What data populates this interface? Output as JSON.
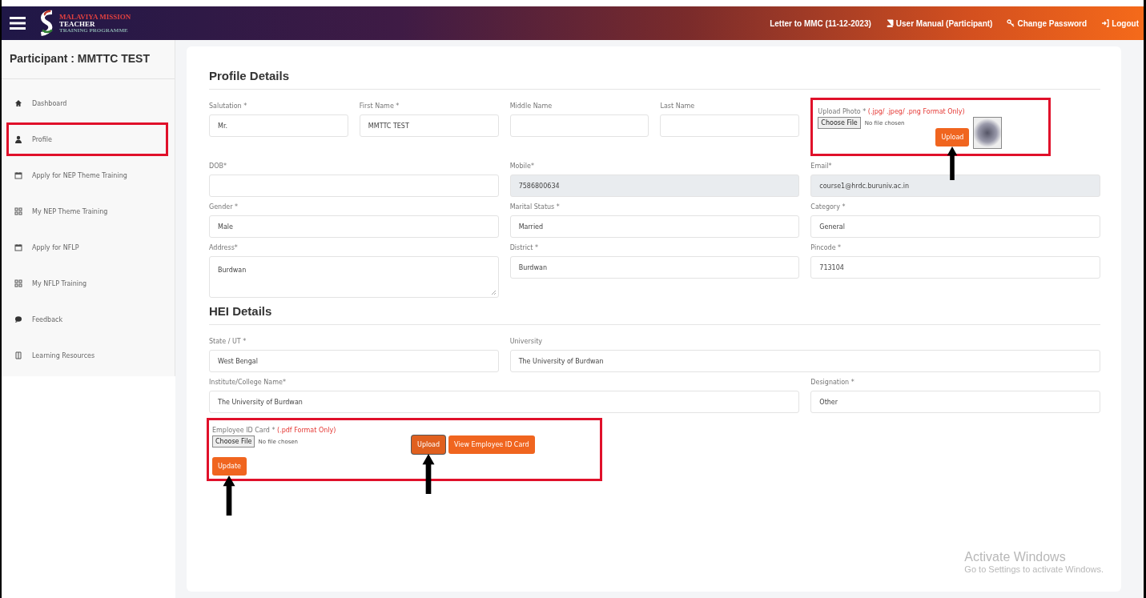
{
  "header": {
    "logo_lines": [
      "MALAVIYA MISSION",
      "TEACHER",
      "TRAINING PROGRAMME"
    ],
    "links": [
      {
        "label": "Letter to MMC (11-12-2023)"
      },
      {
        "label": "User Manual (Participant)"
      },
      {
        "label": "Change Password"
      },
      {
        "label": "Logout"
      }
    ]
  },
  "sidebar": {
    "title": "Participant : MMTTC TEST",
    "items": [
      {
        "label": "Dashboard",
        "highlighted": false
      },
      {
        "label": "Profile",
        "highlighted": true
      },
      {
        "label": "Apply for NEP Theme Training",
        "highlighted": false
      },
      {
        "label": "My NEP Theme Training",
        "highlighted": false
      },
      {
        "label": "Apply for NFLP",
        "highlighted": false
      },
      {
        "label": "My NFLP Training",
        "highlighted": false
      },
      {
        "label": "Feedback",
        "highlighted": false
      },
      {
        "label": "Learning Resources",
        "highlighted": false
      }
    ]
  },
  "sections": [
    {
      "title": "Profile Details",
      "fields": [
        {
          "kind": "input",
          "label": "Salutation *",
          "value": "Mr."
        },
        {
          "kind": "input",
          "label": "First Name *",
          "value": "MMTTC TEST"
        },
        {
          "kind": "input",
          "label": "Middle Name"
        },
        {
          "kind": "input",
          "label": "Last Name"
        },
        {
          "kind": "upload",
          "label": "Upload Photo *",
          "hint": "(.jpg/ .jpeg/ .png Format Only)",
          "choose": "Choose File",
          "file_status": "No file chosen",
          "button": "Upload",
          "pointed": true,
          "highlighted": true,
          "thumbnail": true
        },
        {
          "kind": "input",
          "label": "DOB*"
        },
        {
          "kind": "input",
          "label": "Mobile*",
          "value": "7586800634",
          "readonly": true
        },
        {
          "kind": "input",
          "label": "Email*",
          "value": "course1@hrdc.buruniv.ac.in",
          "readonly": true
        },
        {
          "kind": "input",
          "label": "Gender *",
          "value": "Male"
        },
        {
          "kind": "input",
          "label": "Marital Status *",
          "value": "Married"
        },
        {
          "kind": "input",
          "label": "Category *",
          "value": "General"
        },
        {
          "kind": "textarea",
          "label": "Address*",
          "value": "Burdwan"
        },
        {
          "kind": "input",
          "label": "District *",
          "value": "Burdwan"
        },
        {
          "kind": "input",
          "label": "Pincode *",
          "value": "713104"
        }
      ]
    },
    {
      "title": "HEI Details",
      "fields": [
        {
          "kind": "input",
          "label": "State / UT *",
          "value": "West Bengal"
        },
        {
          "kind": "input",
          "label": "University",
          "value": "The University of Burdwan"
        },
        {
          "kind": "input",
          "label": "Institute/College Name*",
          "value": "The University of Burdwan"
        },
        {
          "kind": "input",
          "label": "Designation *",
          "value": "Other"
        }
      ]
    }
  ],
  "employee_id": {
    "label": "Employee ID Card *",
    "hint": "(.pdf Format Only)",
    "choose": "Choose File",
    "file_status": "No file chosen",
    "upload": "Upload",
    "upload_pointed": true,
    "view": "View Employee ID Card",
    "update": "Update",
    "update_pointed": true,
    "highlighted": true
  },
  "os_notice": {
    "title": "Activate Windows",
    "text": "Go to Settings to activate Windows."
  }
}
